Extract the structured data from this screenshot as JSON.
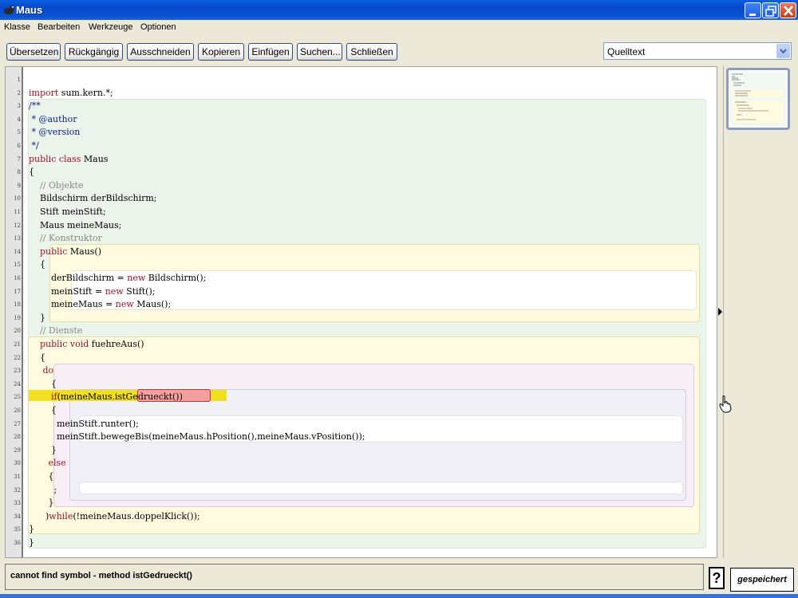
{
  "window": {
    "title": "Maus"
  },
  "menu": [
    "Klasse",
    "Bearbeiten",
    "Werkzeuge",
    "Optionen"
  ],
  "toolbar": {
    "buttons": [
      "Übersetzen",
      "Rückgängig",
      "Ausschneiden",
      "Kopieren",
      "Einfügen",
      "Suchen...",
      "Schließen"
    ],
    "view_select": "Quelltext"
  },
  "editor": {
    "line_numbers": [
      "1",
      "2",
      "3",
      "4",
      "5",
      "6",
      "7",
      "8",
      "9",
      "10",
      "11",
      "12",
      "13",
      "14",
      "15",
      "16",
      "17",
      "18",
      "19",
      "20",
      "21",
      "22",
      "23",
      "24",
      "25",
      "26",
      "27",
      "28",
      "29",
      "30",
      "31",
      "32",
      "33",
      "34",
      "35",
      "36"
    ],
    "lines": [
      "",
      "import sum.kern.*;",
      "/**",
      " * @author",
      " * @version",
      " */",
      "public class Maus",
      "{",
      "    // Objekte",
      "    Bildschirm derBildschirm;",
      "    Stift meinStift;",
      "    Maus meineMaus;",
      "    // Konstruktor",
      "    public Maus()",
      "    {",
      "        derBildschirm = new Bildschirm();",
      "        meinStift = new Stift();",
      "        meineMaus = new Maus();",
      "    }",
      "    // Dienste",
      "    public void fuehreAus()",
      "    {",
      "     do",
      "        {",
      "        if(meineMaus.istGedrueckt())",
      "        {",
      "          meinStift.runter();",
      "          meinStift.bewegeBis(meineMaus.hPosition(),meineMaus.vPosition());",
      "        }",
      "       else",
      "       {",
      "         ;",
      "       }",
      "      )while(!meineMaus.doppelKlick());",
      "}",
      "}"
    ]
  },
  "status": {
    "message": "cannot find symbol - method istGedrueckt()",
    "help_label": "?",
    "saved_label": "gespeichert"
  },
  "colors": {
    "class_block": "#eaf4ea",
    "method_block": "#fefbe0",
    "loop_block": "#f8eef6",
    "if_block": "#f0f0f6",
    "error_highlight": "#f0e020"
  }
}
